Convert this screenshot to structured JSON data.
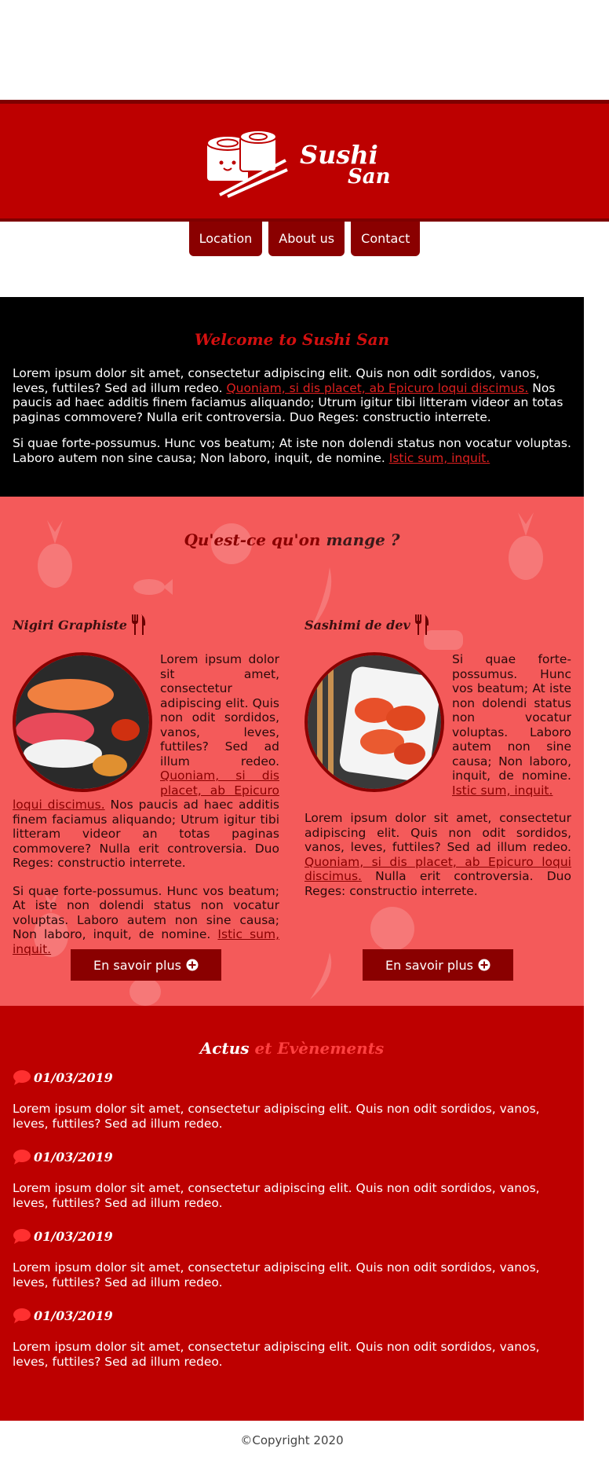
{
  "brand": {
    "name_line1": "Sushi",
    "name_line2": "San"
  },
  "colors": {
    "primary": "#bd0000",
    "dark": "#8a0000",
    "salmon": "#f45a5a",
    "black": "#000000"
  },
  "nav": {
    "items": [
      {
        "label": "Location"
      },
      {
        "label": "About us"
      },
      {
        "label": "Contact"
      }
    ]
  },
  "welcome": {
    "title": "Welcome to Sushi San",
    "p1_text": "Lorem ipsum dolor sit amet, consectetur adipiscing elit. Quis non odit sordidos, vanos, leves, futtiles? Sed ad illum redeo. ",
    "p1_link": "Quoniam, si dis placet, ab Epicuro loqui discimus.",
    "p1_text2": " Nos paucis ad haec additis finem faciamus aliquando; Utrum igitur tibi litteram videor an totas paginas commovere? Nulla erit controversia. Duo Reges: constructio interrete.",
    "p2_text": "Si quae forte-possumus. Hunc vos beatum; At iste non dolendi status non vocatur voluptas. Laboro autem non sine causa; Non laboro, inquit, de nomine. ",
    "p2_link": "Istic sum, inquit."
  },
  "food": {
    "title_part1": "Qu'est-ce qu'on",
    "title_part2": "mange ?",
    "cards": [
      {
        "title": "Nigiri Graphiste",
        "icon": "cutlery-icon",
        "p1_text": "Lorem ipsum dolor sit amet, consectetur adipiscing elit. Quis non odit sordidos, vanos, leves, futtiles? Sed ad illum redeo. ",
        "p1_link": "Quoniam, si dis placet, ab Epicuro loqui discimus.",
        "p1_text2": " Nos paucis ad haec additis finem faciamus aliquando; Utrum igitur tibi litteram videor an totas paginas commovere? Nulla erit controversia. Duo Reges: constructio interrete.",
        "p2_text": "Si quae forte-possumus. Hunc vos beatum; At iste non dolendi status non vocatur voluptas. Laboro autem non sine causa; Non laboro, inquit, de nomine. ",
        "p2_link": "Istic sum, inquit.",
        "button": "En savoir plus"
      },
      {
        "title": "Sashimi de dev",
        "icon": "cutlery-icon",
        "p1_text": "Si quae forte-possumus. Hunc vos beatum; At iste non dolendi status non vocatur voluptas. Laboro autem non sine causa; Non laboro, inquit, de nomine. ",
        "p1_link": "Istic sum, inquit.",
        "p2_text": "Lorem ipsum dolor sit amet, consectetur adipiscing elit. Quis non odit sordidos, vanos, leves, futtiles? Sed ad illum redeo. ",
        "p2_link": "Quoniam, si dis placet, ab Epicuro loqui discimus.",
        "p2_text2": " Nulla erit controversia. Duo Reges: constructio interrete.",
        "button": "En savoir plus"
      }
    ]
  },
  "news": {
    "title_part1": "Actus",
    "title_part2": "et Evènements",
    "items": [
      {
        "date": "01/03/2019",
        "text": "Lorem ipsum dolor sit amet, consectetur adipiscing elit. Quis non odit sordidos, vanos, leves, futtiles? Sed ad illum redeo."
      },
      {
        "date": "01/03/2019",
        "text": "Lorem ipsum dolor sit amet, consectetur adipiscing elit. Quis non odit sordidos, vanos, leves, futtiles? Sed ad illum redeo."
      },
      {
        "date": "01/03/2019",
        "text": "Lorem ipsum dolor sit amet, consectetur adipiscing elit. Quis non odit sordidos, vanos, leves, futtiles? Sed ad illum redeo."
      },
      {
        "date": "01/03/2019",
        "text": "Lorem ipsum dolor sit amet, consectetur adipiscing elit. Quis non odit sordidos, vanos, leves, futtiles? Sed ad illum redeo."
      }
    ]
  },
  "footer": {
    "copyright": "©Copyright 2020"
  }
}
